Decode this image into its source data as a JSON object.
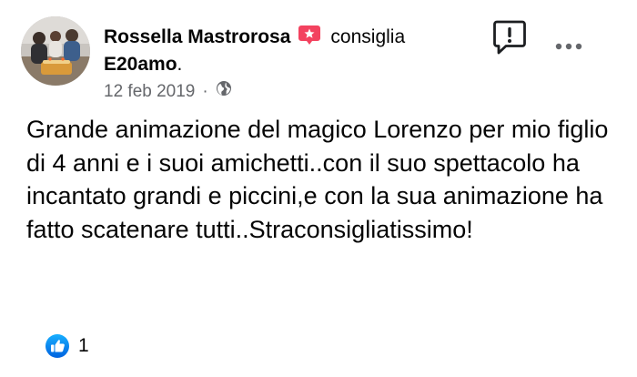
{
  "post": {
    "author": "Rossella Mastrorosa",
    "action": "consiglia",
    "page": "E20amo",
    "page_suffix": ".",
    "date": "12 feb 2019",
    "separator": "·",
    "audience_icon": "globe-icon",
    "recommend_icon": "recommend-tag-icon",
    "report_icon": "report-speech-bubble-icon",
    "more_icon": "more-horizontal-icon",
    "text": "Grande animazione del magico Lorenzo per mio figlio di 4 anni e i suoi amichetti..con il suo spettacolo ha incantato grandi e piccini,e con la sua animazione ha fatto scatenare tutti..Straconsigliatissimo!"
  },
  "reactions": {
    "icon": "like-icon",
    "count": "1"
  },
  "colors": {
    "recommend_red": "#f3425f",
    "like_blue": "#1877f2",
    "meta_gray": "#65676b"
  }
}
